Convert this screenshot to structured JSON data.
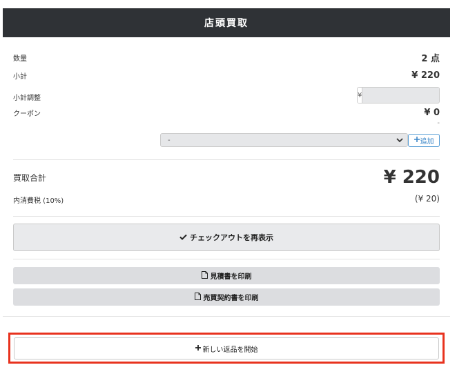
{
  "header": {
    "title": "店頭買取"
  },
  "summary": {
    "quantity_label": "数量",
    "quantity_value": "2 点",
    "subtotal_label": "小計",
    "subtotal_value": "¥ 220",
    "adjust_label": "小計調整",
    "adjust_addon": "¥",
    "adjust_value": "",
    "coupon_label": "クーポン",
    "coupon_value": "¥ 0",
    "coupon_note": "-"
  },
  "coupon_select": {
    "selected": "-",
    "add_label": "追加"
  },
  "total": {
    "label": "買取合計",
    "value": "¥ 220",
    "tax_label": "内消費税 (10%)",
    "tax_value": "(¥ 20)"
  },
  "actions": {
    "checkout_label": "チェックアウトを再表示",
    "print_estimate_label": "見積書を印刷",
    "print_contract_label": "売買契約書を印刷",
    "new_return_label": "新しい返品を開始"
  },
  "colors": {
    "header_bg": "#2f3236",
    "highlight": "#e8321e",
    "link": "#3a86c8"
  },
  "icons": [
    "check-icon",
    "pdf-icon",
    "plus-icon",
    "chevron-down-icon"
  ]
}
